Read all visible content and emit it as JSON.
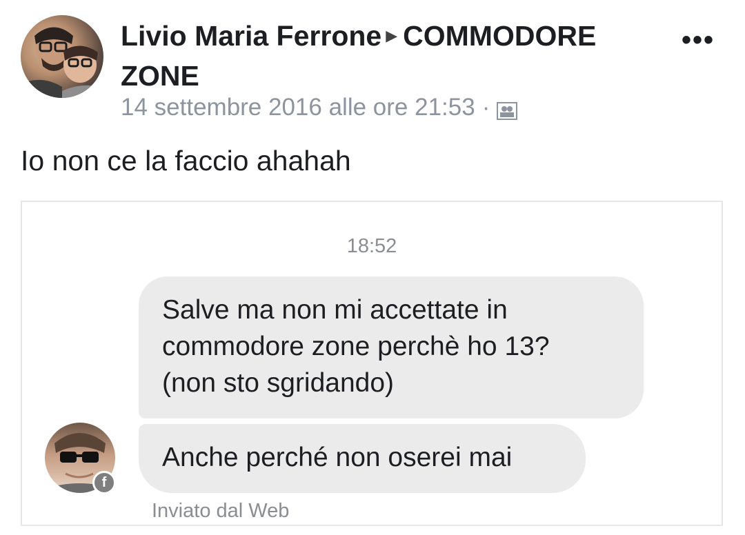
{
  "post": {
    "author": "Livio Maria Ferrone",
    "group": "COMMODORE ZONE",
    "timestamp": "14 settembre 2016 alle ore 21:53",
    "separator": "·",
    "more_label": "•••",
    "text": "Io non ce la faccio ahahah"
  },
  "screenshot": {
    "time": "18:52",
    "messages": [
      {
        "lines": [
          "Salve ma non mi accettate in",
          "commodore zone perchè ho 13?",
          "(non sto sgridando)"
        ]
      },
      {
        "lines": [
          "Anche perché non oserei mai"
        ]
      }
    ],
    "sent_via": "Inviato dal Web",
    "badge_letter": "f"
  },
  "icons": {
    "more": "more-options-icon",
    "audience": "group-audience-icon",
    "arrow": "triangle-right-icon"
  }
}
